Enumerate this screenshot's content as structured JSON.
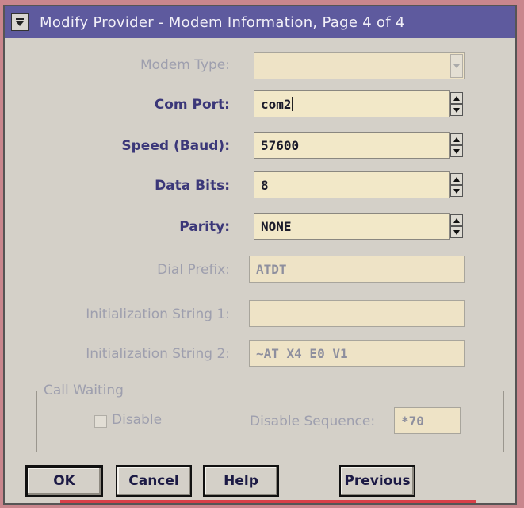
{
  "window": {
    "title": "Modify Provider - Modem Information, Page 4 of 4"
  },
  "icons": {
    "system_menu": "system-menu-icon",
    "spin_up": "spin-up-arrow-icon",
    "spin_down": "spin-down-arrow-icon",
    "dropdown": "dropdown-arrow-icon"
  },
  "fields": {
    "modem_type": {
      "label": "Modem Type:",
      "value": "",
      "enabled": false
    },
    "com_port": {
      "label": "Com Port:",
      "value": "com2",
      "enabled": true
    },
    "speed": {
      "label": "Speed (Baud):",
      "value": "57600",
      "enabled": true
    },
    "data_bits": {
      "label": "Data Bits:",
      "value": "8",
      "enabled": true
    },
    "parity": {
      "label": "Parity:",
      "value": "NONE",
      "enabled": true
    },
    "dial_prefix": {
      "label": "Dial Prefix:",
      "value": "ATDT",
      "enabled": false
    },
    "init_string_1": {
      "label": "Initialization String 1:",
      "value": "",
      "enabled": false
    },
    "init_string_2": {
      "label": "Initialization String 2:",
      "value": "~AT X4 E0 V1",
      "enabled": false
    }
  },
  "call_waiting": {
    "legend": "Call Waiting",
    "disable_label": "Disable",
    "disable_checked": false,
    "sequence_label": "Disable Sequence:",
    "sequence_value": "*70"
  },
  "buttons": {
    "ok": "OK",
    "cancel": "Cancel",
    "help": "Help",
    "previous": "Previous"
  },
  "colors": {
    "title_bar": "#5e5a9e",
    "label": "#3b3779",
    "disabled_label": "#9e9fae",
    "field_bg": "#f2e8c8",
    "dialog_bg": "#d4d0c8",
    "accent_strip": "#d84048"
  }
}
